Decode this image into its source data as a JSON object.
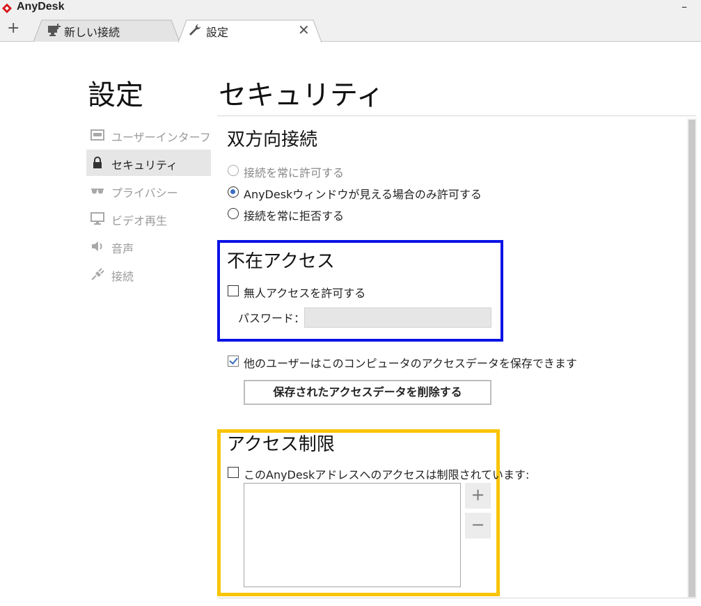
{
  "window": {
    "app_title": "AnyDesk",
    "minimize_glyph": "–",
    "brand_color": "#d51317"
  },
  "tabs": {
    "add_glyph": "+",
    "items": [
      {
        "label": "新しい接続",
        "icon": "new-connection-icon",
        "active": false
      },
      {
        "label": "設定",
        "icon": "wrench-icon",
        "active": true
      }
    ],
    "close_glyph": "✕"
  },
  "sidebar": {
    "title": "設定",
    "items": [
      {
        "label": "ユーザーインターフェ...",
        "icon": "window-icon",
        "active": false
      },
      {
        "label": "セキュリティ",
        "icon": "lock-icon",
        "active": true
      },
      {
        "label": "プライバシー",
        "icon": "glasses-icon",
        "active": false
      },
      {
        "label": "ビデオ再生",
        "icon": "monitor-icon",
        "active": false
      },
      {
        "label": "音声",
        "icon": "speaker-icon",
        "active": false
      },
      {
        "label": "接続",
        "icon": "plug-icon",
        "active": false
      }
    ]
  },
  "content": {
    "heading": "セキュリティ",
    "interactive": {
      "title": "双方向接続",
      "options": [
        {
          "label": "接続を常に許可する",
          "checked": false,
          "disabled": true
        },
        {
          "label": "AnyDeskウィンドウが見える場合のみ許可する",
          "checked": true,
          "disabled": false
        },
        {
          "label": "接続を常に拒否する",
          "checked": false,
          "disabled": false
        }
      ]
    },
    "unattended": {
      "title": "不在アクセス",
      "allow_label": "無人アクセスを許可する",
      "allow_checked": false,
      "password_label": "パスワード：",
      "password_value": ""
    },
    "save_access": {
      "label": "他のユーザーはこのコンピュータのアクセスデータを保存できます",
      "checked": true,
      "delete_button": "保存されたアクセスデータを削除する"
    },
    "access_control": {
      "title": "アクセス制限",
      "restrict_label": "このAnyDeskアドレスへのアクセスは制限されています:",
      "restrict_checked": false,
      "add_glyph": "+",
      "remove_glyph": "−"
    }
  },
  "annotations": {
    "blue_box_color": "#0a12e6",
    "yellow_box_color": "#f9c400"
  }
}
